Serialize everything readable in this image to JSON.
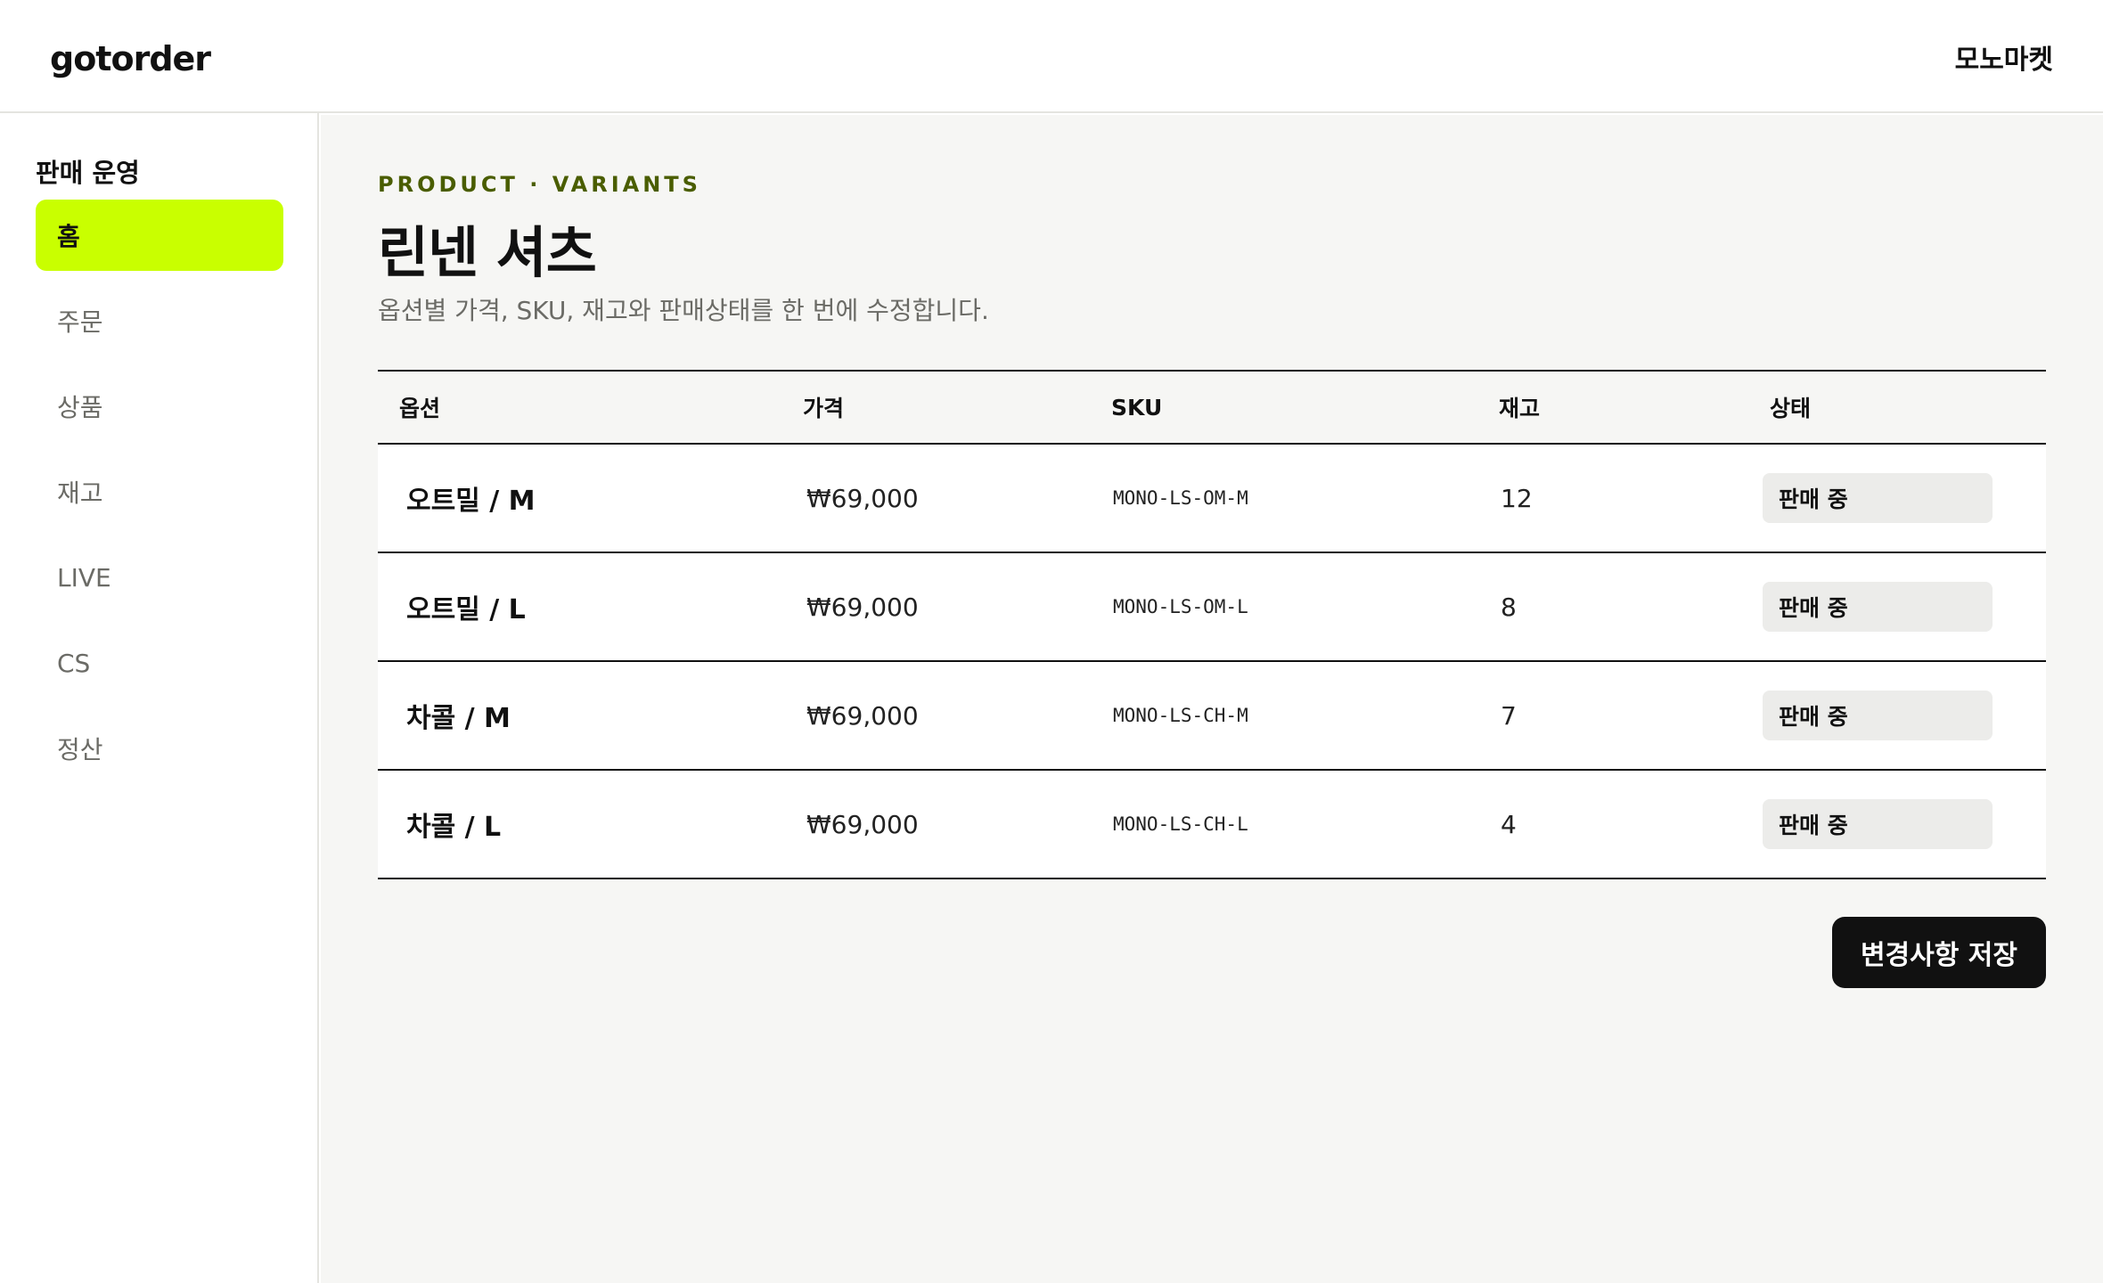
{
  "header": {
    "logo": "gotorder",
    "store_name": "모노마켓"
  },
  "sidebar": {
    "section_title": "판매 운영",
    "items": [
      {
        "label": "홈",
        "active": true
      },
      {
        "label": "주문",
        "active": false
      },
      {
        "label": "상품",
        "active": false
      },
      {
        "label": "재고",
        "active": false
      },
      {
        "label": "LIVE",
        "active": false
      },
      {
        "label": "CS",
        "active": false
      },
      {
        "label": "정산",
        "active": false
      }
    ]
  },
  "main": {
    "eyebrow": "PRODUCT · VARIANTS",
    "title": "린넨 셔츠",
    "description": "옵션별 가격, SKU, 재고와 판매상태를 한 번에 수정합니다.",
    "table": {
      "headers": {
        "option": "옵션",
        "price": "가격",
        "sku": "SKU",
        "stock": "재고",
        "status": "상태"
      },
      "rows": [
        {
          "option": "오트밀 / M",
          "price": "₩69,000",
          "sku": "MONO-LS-OM-M",
          "stock": "12",
          "status": "판매 중"
        },
        {
          "option": "오트밀 / L",
          "price": "₩69,000",
          "sku": "MONO-LS-OM-L",
          "stock": "8",
          "status": "판매 중"
        },
        {
          "option": "차콜 / M",
          "price": "₩69,000",
          "sku": "MONO-LS-CH-M",
          "stock": "7",
          "status": "판매 중"
        },
        {
          "option": "차콜 / L",
          "price": "₩69,000",
          "sku": "MONO-LS-CH-L",
          "stock": "4",
          "status": "판매 중"
        }
      ]
    },
    "save_label": "변경사항 저장"
  },
  "colors": {
    "accent": "#c9ff00",
    "eyebrow": "#4a5d00",
    "primary_button": "#111111",
    "background": "#f6f6f4"
  }
}
